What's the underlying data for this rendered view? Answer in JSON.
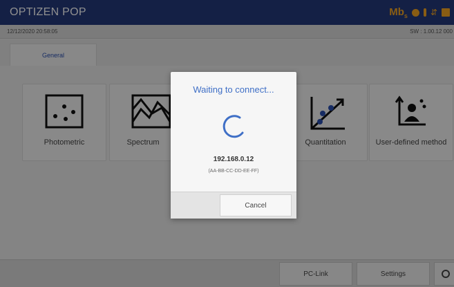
{
  "header": {
    "title": "OPTIZEN POP",
    "status_icons": [
      "mb-icon",
      "lamp-icon",
      "temperature-icon",
      "usb-icon",
      "printer-icon"
    ],
    "mb_text": "Mb",
    "mb_sub": "s",
    "usb_glyph": "⇵"
  },
  "infobar": {
    "datetime": "12/12/2020 20:58:05",
    "sw": "SW : 1.00.12 000"
  },
  "tabs": [
    {
      "label": "General",
      "selected": true
    }
  ],
  "tiles": [
    {
      "label": "Photometric",
      "icon": "scatter-box-icon"
    },
    {
      "label": "Spectrum",
      "icon": "spectrum-wave-icon"
    },
    {
      "label": "Quantitation",
      "icon": "quantitation-icon"
    },
    {
      "label": "User-defined method",
      "icon": "user-defined-icon"
    }
  ],
  "footer": {
    "pclink_label": "PC-Link",
    "settings_label": "Settings"
  },
  "dialog": {
    "title": "Waiting to connect...",
    "ip": "192.168.0.12",
    "mac": "(AA-BB-CC-DD-EE-FF)",
    "cancel_label": "Cancel"
  },
  "colors": {
    "header_bg": "#243a7c",
    "accent_orange": "#f5a623",
    "dialog_title": "#3f6fc6",
    "spinner": "#3f6fc6"
  }
}
